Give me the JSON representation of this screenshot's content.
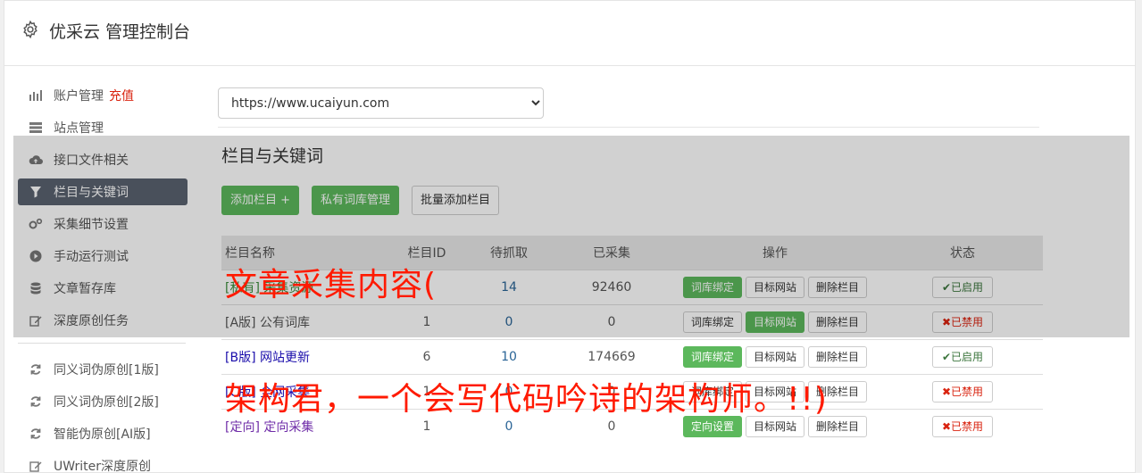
{
  "app": {
    "title": "优采云 管理控制台"
  },
  "sidebar": {
    "items": [
      {
        "label": "账户管理",
        "extra": "充值",
        "icon": "bar-chart-icon"
      },
      {
        "label": "站点管理",
        "icon": "server-icon"
      },
      {
        "label": "接口文件相关",
        "icon": "cloud-upload-icon"
      },
      {
        "label": "栏目与关键词",
        "icon": "filter-icon",
        "active": true
      },
      {
        "label": "采集细节设置",
        "icon": "gears-icon"
      },
      {
        "label": "手动运行测试",
        "icon": "play-circle-icon"
      },
      {
        "label": "文章暂存库",
        "icon": "database-icon"
      },
      {
        "label": "深度原创任务",
        "icon": "edit-icon"
      }
    ],
    "items2": [
      {
        "label": "同义词伪原创[1版]",
        "icon": "refresh-icon"
      },
      {
        "label": "同义词伪原创[2版]",
        "icon": "refresh-icon"
      },
      {
        "label": "智能伪原创[AI版]",
        "icon": "refresh-icon"
      },
      {
        "label": "UWriter深度原创",
        "icon": "edit-icon"
      }
    ]
  },
  "site_select": {
    "value": "https://www.ucaiyun.com"
  },
  "section": {
    "title": "栏目与关键词"
  },
  "toolbar": {
    "add_column": "添加栏目 +",
    "private_lib": "私有词库管理",
    "batch_add": "批量添加栏目"
  },
  "table": {
    "headers": [
      "栏目名称",
      "栏目ID",
      "待抓取",
      "已采集",
      "操作",
      "状态"
    ],
    "rows": [
      {
        "name": "[私有] 采集资源",
        "id": "",
        "pending": "14",
        "collected": "92460",
        "op1": "词库绑定",
        "op2": "目标网站",
        "op3": "删除栏目",
        "status": "已启用"
      },
      {
        "name": "[A版] 公有词库",
        "id": "1",
        "pending": "0",
        "collected": "0",
        "op1": "词库绑定",
        "op2": "目标网站",
        "op3": "删除栏目",
        "status": "已禁用"
      },
      {
        "name": "[B版] 网站更新",
        "id": "6",
        "pending": "10",
        "collected": "174669",
        "op1": "词库绑定",
        "op2": "目标网站",
        "op3": "删除栏目",
        "status": "已启用"
      },
      {
        "name": "[C版] 全网采集",
        "id": "1",
        "pending": "0",
        "collected": "0",
        "op1": "词库绑定",
        "op2": "目标网站",
        "op3": "删除栏目",
        "status": "已禁用"
      },
      {
        "name": "[定向] 定向采集",
        "id": "1",
        "pending": "0",
        "collected": "0",
        "op1": "定向设置",
        "op2": "目标网站",
        "op3": "删除栏目",
        "status": "已禁用"
      }
    ]
  },
  "watermark": {
    "line1": "文章采集内容(",
    "line2": "架构君，一个会写代码吟诗的架构师。!!)"
  }
}
